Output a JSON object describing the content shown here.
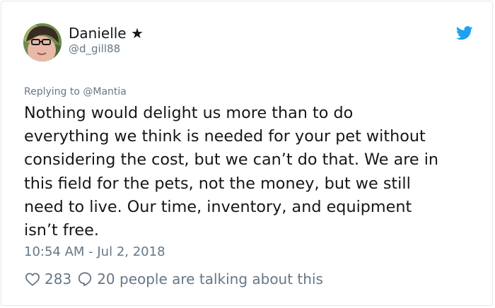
{
  "user": {
    "display_name": "Danielle ★",
    "handle": "@d_gill88"
  },
  "reply": {
    "prefix": "Replying to ",
    "to": "@Mantia"
  },
  "tweet": {
    "lines": [
      "Nothing would delight us more than to do",
      "everything we think is needed for your pet without",
      "considering the cost, but we can’t do that. We are in",
      "this field for the pets, not the money, but we still",
      "need to live. Our time, inventory, and equipment",
      "isn’t free."
    ],
    "timestamp": "10:54 AM - Jul 2, 2018"
  },
  "engagement": {
    "likes": "283",
    "talking": "20 people are talking about this"
  },
  "icons": {
    "brand": "twitter-bird-icon",
    "like": "heart-icon",
    "reply": "speech-bubble-icon"
  },
  "colors": {
    "brand": "#1da1f2",
    "text": "#14171a",
    "secondary": "#657786",
    "border": "#e1e8ed"
  }
}
